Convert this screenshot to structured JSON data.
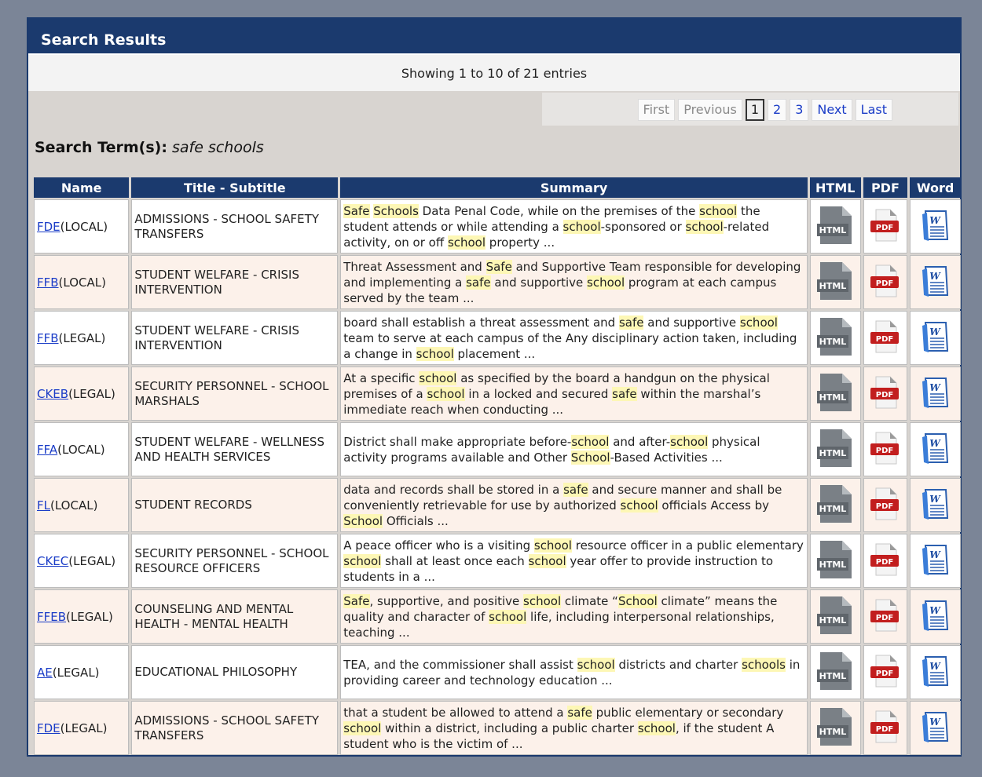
{
  "panel": {
    "title": "Search Results"
  },
  "info": {
    "showing": "Showing 1 to 10 of 21 entries"
  },
  "pager": {
    "first": "First",
    "previous": "Previous",
    "pages": [
      "1",
      "2",
      "3"
    ],
    "current": "1",
    "next": "Next",
    "last": "Last"
  },
  "search": {
    "label": "Search Term(s):",
    "term": "safe schools"
  },
  "table": {
    "headers": {
      "name": "Name",
      "title": "Title - Subtitle",
      "summary": "Summary",
      "html": "HTML",
      "pdf": "PDF",
      "word": "Word"
    },
    "rows": [
      {
        "code": "FDE",
        "suffix": "(LOCAL)",
        "title": "ADMISSIONS - SCHOOL SAFETY TRANSFERS",
        "summary": [
          [
            "Safe",
            1
          ],
          [
            " ",
            0
          ],
          [
            "Schools",
            1
          ],
          [
            " Data Penal Code, while on the premises of the ",
            0
          ],
          [
            "school",
            1
          ],
          [
            " the student attends or while attending a ",
            0
          ],
          [
            "school",
            1
          ],
          [
            "-sponsored or ",
            0
          ],
          [
            "school",
            1
          ],
          [
            "-related activity, on or off ",
            0
          ],
          [
            "school",
            1
          ],
          [
            " property ...",
            0
          ]
        ]
      },
      {
        "code": "FFB",
        "suffix": "(LOCAL)",
        "title": "STUDENT WELFARE - CRISIS INTERVENTION",
        "summary": [
          [
            "Threat Assessment and ",
            0
          ],
          [
            "Safe",
            1
          ],
          [
            " and Supportive Team responsible for developing and implementing a ",
            0
          ],
          [
            "safe",
            1
          ],
          [
            " and supportive ",
            0
          ],
          [
            "school",
            1
          ],
          [
            " program at each campus served by the team ...",
            0
          ]
        ]
      },
      {
        "code": "FFB",
        "suffix": "(LEGAL)",
        "title": "STUDENT WELFARE - CRISIS INTERVENTION",
        "summary": [
          [
            "board shall establish a threat assessment and ",
            0
          ],
          [
            "safe",
            1
          ],
          [
            " and supportive ",
            0
          ],
          [
            "school",
            1
          ],
          [
            " team to serve at each campus of the Any disciplinary action taken, including a change in ",
            0
          ],
          [
            "school",
            1
          ],
          [
            " placement ...",
            0
          ]
        ]
      },
      {
        "code": "CKEB",
        "suffix": "(LEGAL)",
        "title": "SECURITY PERSONNEL - SCHOOL MARSHALS",
        "summary": [
          [
            "At a specific ",
            0
          ],
          [
            "school",
            1
          ],
          [
            " as specified by the board a handgun on the physical premises of a ",
            0
          ],
          [
            "school",
            1
          ],
          [
            " in a locked and secured ",
            0
          ],
          [
            "safe",
            1
          ],
          [
            " within the marshal’s immediate reach when conducting ...",
            0
          ]
        ]
      },
      {
        "code": "FFA",
        "suffix": "(LOCAL)",
        "title": "STUDENT WELFARE - WELLNESS AND HEALTH SERVICES",
        "summary": [
          [
            "District shall make appropriate before-",
            0
          ],
          [
            "school",
            1
          ],
          [
            " and after-",
            0
          ],
          [
            "school",
            1
          ],
          [
            " physical activity programs available and Other ",
            0
          ],
          [
            "School",
            1
          ],
          [
            "-Based Activities ...",
            0
          ]
        ]
      },
      {
        "code": "FL",
        "suffix": "(LOCAL)",
        "title": "STUDENT RECORDS",
        "summary": [
          [
            "data and records shall be stored in a ",
            0
          ],
          [
            "safe",
            1
          ],
          [
            " and secure manner and shall be conveniently retrievable for use by authorized ",
            0
          ],
          [
            "school",
            1
          ],
          [
            " officials Access by ",
            0
          ],
          [
            "School",
            1
          ],
          [
            " Officials ...",
            0
          ]
        ]
      },
      {
        "code": "CKEC",
        "suffix": "(LEGAL)",
        "title": "SECURITY PERSONNEL - SCHOOL RESOURCE OFFICERS",
        "summary": [
          [
            "A peace officer who is a visiting ",
            0
          ],
          [
            "school",
            1
          ],
          [
            " resource officer in a public elementary ",
            0
          ],
          [
            "school",
            1
          ],
          [
            " shall at least once each ",
            0
          ],
          [
            "school",
            1
          ],
          [
            " year offer to provide instruction to students in a ...",
            0
          ]
        ]
      },
      {
        "code": "FFEB",
        "suffix": "(LEGAL)",
        "title": "COUNSELING AND MENTAL HEALTH - MENTAL HEALTH",
        "summary": [
          [
            "Safe",
            1
          ],
          [
            ", supportive, and positive ",
            0
          ],
          [
            "school",
            1
          ],
          [
            " climate “",
            0
          ],
          [
            "School",
            1
          ],
          [
            " climate” means the quality and character of ",
            0
          ],
          [
            "school",
            1
          ],
          [
            " life, including interpersonal relationships, teaching ...",
            0
          ]
        ]
      },
      {
        "code": "AE",
        "suffix": "(LEGAL)",
        "title": "EDUCATIONAL PHILOSOPHY",
        "summary": [
          [
            "TEA, and the commissioner shall assist ",
            0
          ],
          [
            "school",
            1
          ],
          [
            " districts and charter ",
            0
          ],
          [
            "schools",
            1
          ],
          [
            " in providing career and technology education ...",
            0
          ]
        ]
      },
      {
        "code": "FDE",
        "suffix": "(LEGAL)",
        "title": "ADMISSIONS - SCHOOL SAFETY TRANSFERS",
        "summary": [
          [
            "that a student be allowed to attend a ",
            0
          ],
          [
            "safe",
            1
          ],
          [
            " public elementary or secondary ",
            0
          ],
          [
            "school",
            1
          ],
          [
            " within a district, including a public charter ",
            0
          ],
          [
            "school",
            1
          ],
          [
            ", if the student A student who is the victim of ...",
            0
          ]
        ]
      }
    ],
    "icon_labels": {
      "html": "HTML",
      "pdf": "PDF",
      "word": "W"
    }
  },
  "colors": {
    "header": "#1b3a6e",
    "highlight": "#fdf7b5",
    "link": "#1a3cc7",
    "row_alt": "#fcf1ea"
  }
}
